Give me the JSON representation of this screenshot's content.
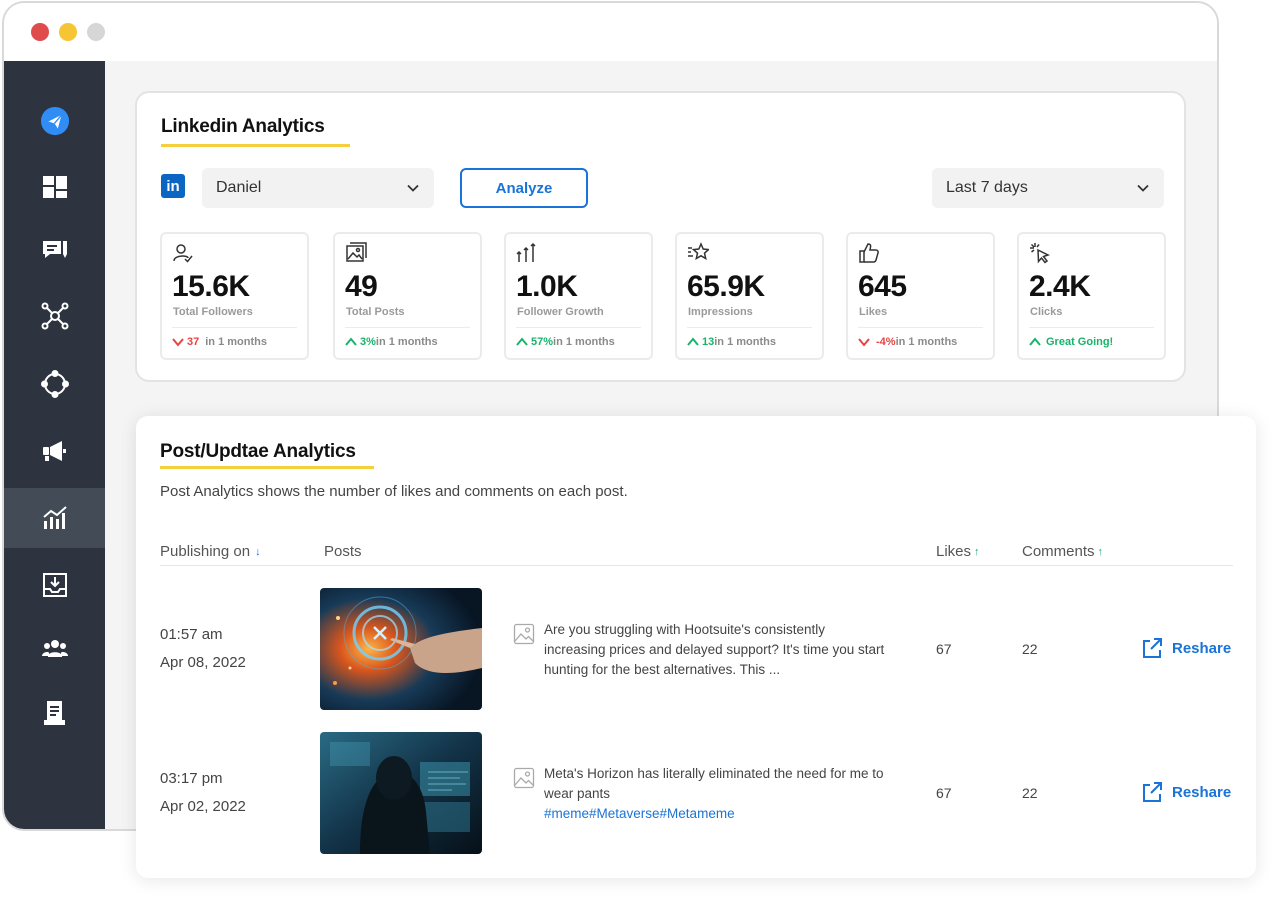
{
  "window": {
    "traffic_lights": [
      "close",
      "minimize",
      "zoom"
    ]
  },
  "sidebar": {
    "items": [
      {
        "icon": "send-logo-icon"
      },
      {
        "icon": "dashboard-icon"
      },
      {
        "icon": "posts-icon"
      },
      {
        "icon": "network-icon"
      },
      {
        "icon": "connections-icon"
      },
      {
        "icon": "megaphone-icon"
      },
      {
        "icon": "analytics-icon",
        "active": true
      },
      {
        "icon": "inbox-download-icon"
      },
      {
        "icon": "team-icon"
      },
      {
        "icon": "document-icon"
      }
    ]
  },
  "linkedin": {
    "title": "Linkedin Analytics",
    "logo": "in",
    "account": "Daniel",
    "analyze_label": "Analyze",
    "range": "Last 7 days",
    "stats": [
      {
        "icon": "user-check-icon",
        "value": "15.6K",
        "label": "Total Followers",
        "trend": "down",
        "delta": "37",
        "period": " in 1 months"
      },
      {
        "icon": "image-icon",
        "value": "49",
        "label": "Total Posts",
        "trend": "up",
        "delta": "3%",
        "period": " in 1 months"
      },
      {
        "icon": "growth-arrows-icon",
        "value": "1.0K",
        "label": "Follower Growth",
        "trend": "up",
        "delta": "57%",
        "period": " in 1 months"
      },
      {
        "icon": "star-icon",
        "value": "65.9K",
        "label": "Impressions",
        "trend": "up",
        "delta": "13",
        "period": " in 1 months"
      },
      {
        "icon": "thumbs-up-icon",
        "value": "645",
        "label": "Likes",
        "trend": "down",
        "delta": "-4%",
        "period": " in 1 months"
      },
      {
        "icon": "cursor-click-icon",
        "value": "2.4K",
        "label": "Clicks",
        "trend": "up",
        "delta": "Great Going!",
        "period": ""
      }
    ],
    "colors": {
      "up": "#19b36b",
      "down": "#e84343",
      "accent": "#1a73d6",
      "underline": "#f5cf3d"
    }
  },
  "posts": {
    "title": "Post/Updtae Analytics",
    "description": "Post Analytics shows the number of likes and comments on each post.",
    "columns": {
      "publishing": "Publishing on",
      "posts": "Posts",
      "likes": "Likes",
      "comments": "Comments"
    },
    "sort_icons": {
      "publishing": "↓",
      "likes": "↑",
      "comments": "↑"
    },
    "rows": [
      {
        "time": "01:57 am",
        "date": "Apr 08, 2022",
        "text": "Are you struggling with Hootsuite's consistently increasing prices and delayed support? It's time you start hunting for the best alternatives. This ...",
        "tags": "",
        "likes": "67",
        "comments": "22",
        "action": "Reshare"
      },
      {
        "time": "03:17 pm",
        "date": "Apr 02, 2022",
        "text": "Meta's Horizon has literally eliminated the need for me to wear pants",
        "tags": "#meme#Metaverse#Metameme",
        "likes": "67",
        "comments": "22",
        "action": "Reshare"
      }
    ]
  }
}
